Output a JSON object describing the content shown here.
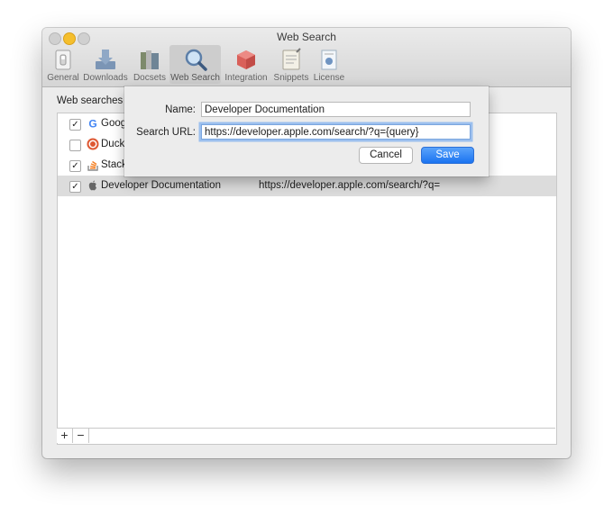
{
  "window": {
    "title": "Web Search"
  },
  "toolbar": {
    "tabs": [
      {
        "label": "General",
        "icon": "switch-icon"
      },
      {
        "label": "Downloads",
        "icon": "download-tray-icon"
      },
      {
        "label": "Docsets",
        "icon": "books-icon"
      },
      {
        "label": "Web Search",
        "icon": "magnifier-icon",
        "active": true
      },
      {
        "label": "Integration",
        "icon": "cube-icon"
      },
      {
        "label": "Snippets",
        "icon": "notepad-icon"
      },
      {
        "label": "License",
        "icon": "certificate-icon"
      }
    ]
  },
  "main": {
    "section_label": "Web searches a",
    "rows": [
      {
        "checked": true,
        "check_mark": "✓",
        "icon": "google-icon",
        "name": "Goog",
        "url": ""
      },
      {
        "checked": false,
        "check_mark": "",
        "icon": "duckduckgo-icon",
        "name": "Duck",
        "url": ""
      },
      {
        "checked": true,
        "check_mark": "✓",
        "icon": "stackoverflow-icon",
        "name": "Stack",
        "url": ""
      },
      {
        "checked": true,
        "check_mark": "✓",
        "icon": "apple-icon",
        "name": " Developer Documentation",
        "url": "https://developer.apple.com/search/?q="
      }
    ],
    "add_button": "+",
    "remove_button": "−"
  },
  "sheet": {
    "name_label": "Name:",
    "name_value": " Developer Documentation",
    "url_label": "Search URL:",
    "url_value": "https://developer.apple.com/search/?q={query}",
    "cancel_label": "Cancel",
    "save_label": "Save"
  },
  "colors": {
    "accent": "#1a73f0",
    "focus_ring": "#9cc0ee",
    "selected_row": "#dcdcdc"
  }
}
